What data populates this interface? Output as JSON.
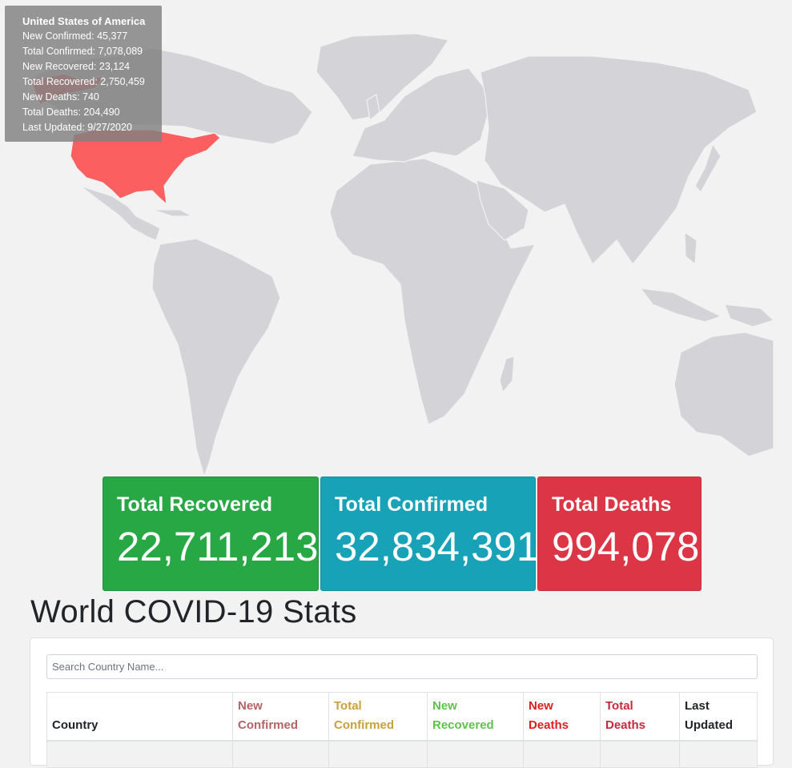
{
  "map": {
    "highlighted_country": "United States of America",
    "highlight_color": "#fb5f5f",
    "land_color": "#d3d3d8"
  },
  "tooltip": {
    "title": "United States of America",
    "new_confirmed": "New Confirmed: 45,377",
    "total_confirmed": "Total Confirmed: 7,078,089",
    "new_recovered": "New Recovered: 23,124",
    "total_recovered": "Total Recovered: 2,750,459",
    "new_deaths": "New Deaths: 740",
    "total_deaths": "Total Deaths: 204,490",
    "last_updated": "Last Updated: 9/27/2020"
  },
  "cards": {
    "recovered": {
      "label": "Total Recovered",
      "value": "22,711,213",
      "color": "#28a745"
    },
    "confirmed": {
      "label": "Total Confirmed",
      "value": "32,834,391",
      "color": "#17a2b8"
    },
    "deaths": {
      "label": "Total Deaths",
      "value": "994,078",
      "color": "#dc3545"
    }
  },
  "page_title": "World COVID-19 Stats",
  "search": {
    "placeholder": "Search Country Name...",
    "value": ""
  },
  "table": {
    "columns": [
      {
        "label": "Country",
        "color": "#212529"
      },
      {
        "label": "New Confirmed",
        "color": "#b46464"
      },
      {
        "label": "Total Confirmed",
        "color": "#c9a13c"
      },
      {
        "label": "New Recovered",
        "color": "#5ec24a"
      },
      {
        "label": "New Deaths",
        "color": "#dc1e1e"
      },
      {
        "label": "Total Deaths",
        "color": "#c8283c"
      },
      {
        "label": "Last Updated",
        "color": "#212529"
      }
    ]
  }
}
